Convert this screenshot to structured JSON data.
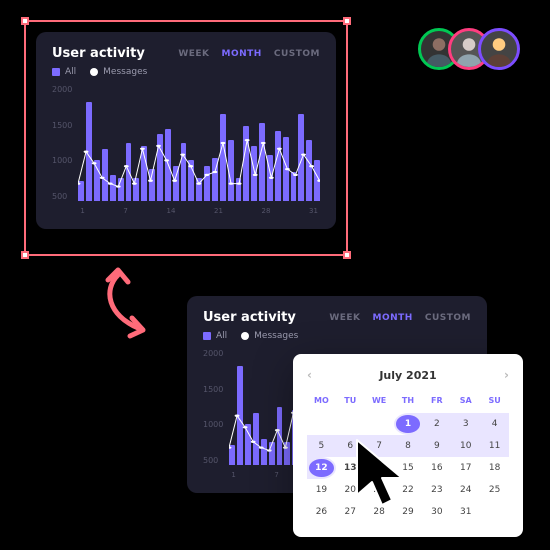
{
  "card": {
    "title": "User activity",
    "tabs": {
      "week": "WEEK",
      "month": "MONTH",
      "custom": "CUSTOM",
      "active": "month"
    },
    "legend": {
      "all": "All",
      "messages": "Messages"
    }
  },
  "chart_data": {
    "type": "bar+line",
    "title": "User activity",
    "ylabel": "",
    "xlabel": "day",
    "ylim": [
      0,
      2000
    ],
    "y_ticks": [
      2000,
      1500,
      1000,
      500
    ],
    "x_ticks": [
      "1",
      "7",
      "14",
      "21",
      "28",
      "31"
    ],
    "categories": [
      1,
      2,
      3,
      4,
      5,
      6,
      7,
      8,
      9,
      10,
      11,
      12,
      13,
      14,
      15,
      16,
      17,
      18,
      19,
      20,
      21,
      22,
      23,
      24,
      25,
      26,
      27,
      28,
      29,
      30,
      31
    ],
    "series": [
      {
        "name": "All",
        "type": "bar",
        "color": "#7c6bff",
        "values": [
          350,
          1700,
          700,
          900,
          450,
          400,
          1000,
          400,
          950,
          550,
          1150,
          1250,
          600,
          1000,
          700,
          400,
          600,
          750,
          1500,
          1050,
          400,
          1300,
          950,
          1350,
          800,
          1200,
          1100,
          500,
          1500,
          1050,
          700
        ]
      },
      {
        "name": "Messages",
        "type": "line",
        "color": "#ffffff",
        "values": [
          300,
          850,
          650,
          400,
          300,
          250,
          600,
          300,
          900,
          350,
          950,
          700,
          350,
          800,
          600,
          300,
          450,
          500,
          1000,
          300,
          300,
          1050,
          450,
          1000,
          400,
          900,
          550,
          450,
          800,
          600,
          350
        ]
      }
    ]
  },
  "avatars": {
    "colors": [
      "#00c853",
      "#ff3d7f",
      "#7c4dff"
    ]
  },
  "calendar": {
    "month_label": "July 2021",
    "dow": [
      "MO",
      "TU",
      "WE",
      "TH",
      "FR",
      "SA",
      "SU"
    ],
    "selected": [
      1,
      12
    ],
    "range": [
      1,
      12
    ],
    "bold_day": 13,
    "days_in_month": 31,
    "first_dow_index": 3
  },
  "selection": {
    "accent": "#ff6b7a"
  }
}
